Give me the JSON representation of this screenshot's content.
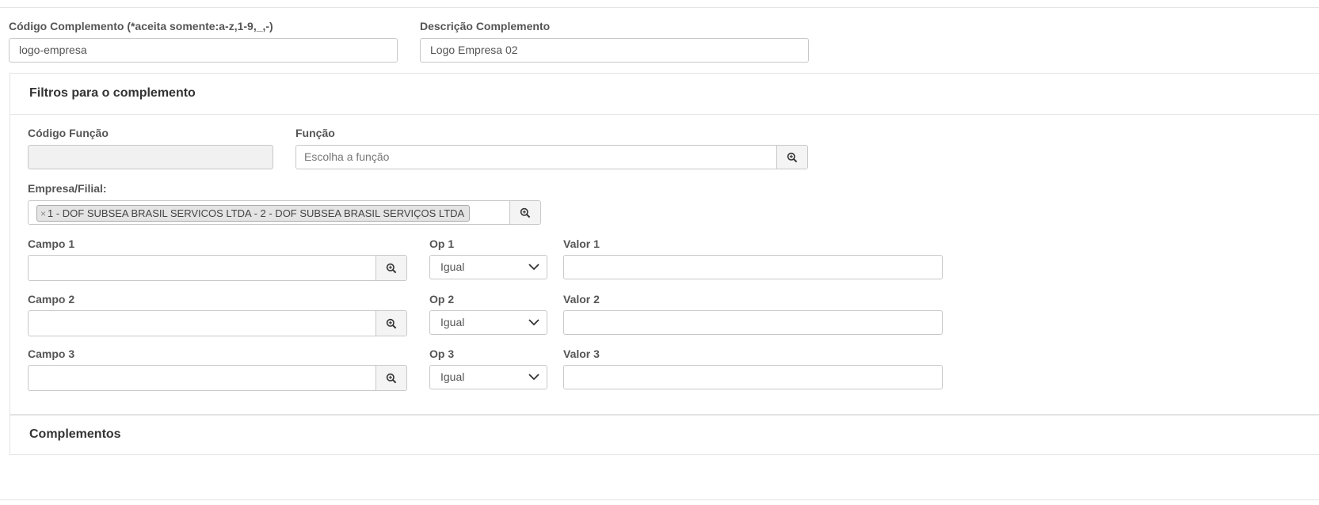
{
  "form": {
    "codigo": {
      "label": "Código Complemento (*aceita somente:a-z,1-9,_,-)",
      "value": "logo-empresa"
    },
    "descricao": {
      "label": "Descrição Complemento",
      "value": "Logo Empresa 02"
    }
  },
  "filtros": {
    "title": "Filtros para o complemento",
    "codigo_funcao": {
      "label": "Código Função",
      "value": ""
    },
    "funcao": {
      "label": "Função",
      "placeholder": "Escolha a função"
    },
    "empresa": {
      "label": "Empresa/Filial:",
      "remove_glyph": "×",
      "tag": "1 - DOF SUBSEA BRASIL SERVICOS LTDA - 2 - DOF SUBSEA BRASIL SERVIÇOS LTDA"
    },
    "rows": [
      {
        "campo_label": "Campo 1",
        "op_label": "Op 1",
        "op_value": "Igual",
        "valor_label": "Valor 1"
      },
      {
        "campo_label": "Campo 2",
        "op_label": "Op 2",
        "op_value": "Igual",
        "valor_label": "Valor 2"
      },
      {
        "campo_label": "Campo 3",
        "op_label": "Op 3",
        "op_value": "Igual",
        "valor_label": "Valor 3"
      }
    ]
  },
  "complementos": {
    "title": "Complementos"
  },
  "icons": {
    "search": "zoom-in-icon",
    "dropdown": "chevron-down-icon"
  },
  "colors": {
    "border": "#c8c8c8",
    "addon_bg": "#f4f4f4",
    "readonly_bg": "#f1f1f1",
    "tag_bg": "#e4e4e4"
  }
}
